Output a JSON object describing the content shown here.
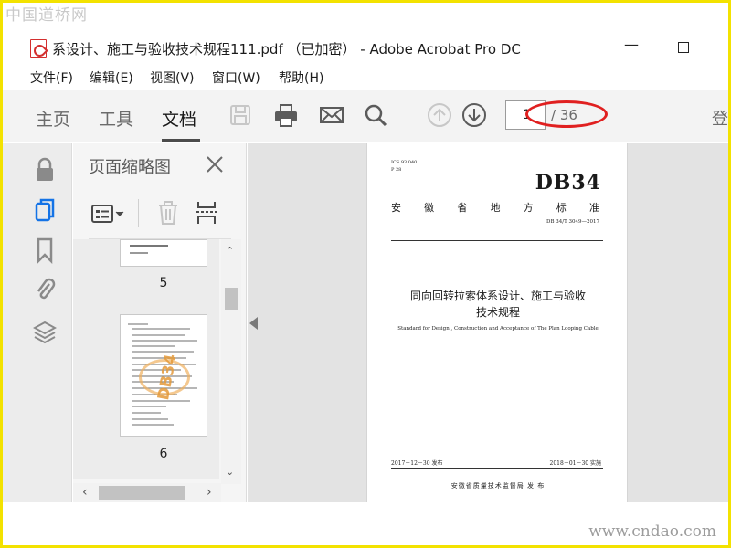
{
  "watermarks": {
    "top_left": "中国道桥网",
    "bottom_right": "www.cndao.com"
  },
  "window": {
    "title": "系设计、施工与验收技术规程111.pdf （已加密） - Adobe Acrobat Pro DC",
    "minimize": "—"
  },
  "menu": [
    "文件(F)",
    "编辑(E)",
    "视图(V)",
    "窗口(W)",
    "帮助(H)"
  ],
  "tabs": [
    "主页",
    "工具",
    "文档"
  ],
  "page_nav": {
    "current": "1",
    "total": "/ 36"
  },
  "toolbar": {
    "login_partial": "登"
  },
  "colors": {
    "annotation_ellipse": "#e02020",
    "frame": "#f3e200"
  },
  "panel": {
    "title": "页面缩略图",
    "thumbnails": [
      {
        "label": "5"
      },
      {
        "label": "6",
        "stamp": "DB34"
      }
    ]
  },
  "document": {
    "ics": "ICS 93.040",
    "ccs": "P 28",
    "code": "DB34",
    "province": [
      "安",
      "徽",
      "省",
      "地",
      "方",
      "标",
      "准"
    ],
    "number": "DB 34/T 3049—2017",
    "title_line1": "同向回转拉索体系设计、施工与验收",
    "title_line2": "技术规程",
    "subtitle": "Standard for Design , Construction and Acceptance of The Plan Looping Cable",
    "publish_date": "2017－12－30 发布",
    "implement_date": "2018－01－30 实施",
    "issuer": "安徽省质量技术监督局    发 布"
  }
}
